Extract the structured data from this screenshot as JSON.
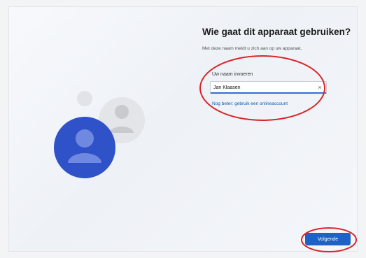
{
  "page": {
    "title": "Wie gaat dit apparaat gebruiken?",
    "subtitle": "Met deze naam meldt u zich aan op uw apparaat."
  },
  "name_field": {
    "label": "Uw naam invoeren",
    "value": "Jan Klaasen",
    "clear_glyph": "×"
  },
  "links": {
    "online_account": "Nog beter: gebruik een onlineaccount"
  },
  "buttons": {
    "next_label": "Volgende"
  },
  "colors": {
    "accent": "#1f62c6",
    "annotation": "#d8262a"
  },
  "icons": [
    "user-avatar-illustration",
    "clear-icon"
  ]
}
